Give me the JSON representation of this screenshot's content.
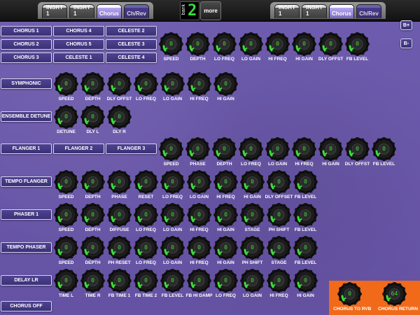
{
  "topbar": {
    "left_tabs": [
      {
        "label": "INSRT 1",
        "state": "normal"
      },
      {
        "label": "INSRT 1",
        "state": "normal"
      },
      {
        "label": "Chorus",
        "state": "active"
      },
      {
        "label": "Ch/Rev",
        "state": "dark"
      }
    ],
    "right_tabs": [
      {
        "label": "INSRT 1",
        "state": "normal"
      },
      {
        "label": "INSRT 1",
        "state": "normal"
      },
      {
        "label": "Chorus",
        "state": "active"
      },
      {
        "label": "Ch/Rev",
        "state": "dark"
      }
    ],
    "bank_label": "bank",
    "bank_number": "2",
    "more_label": "more"
  },
  "bank_buttons": {
    "plus": "B+",
    "minus": "B-"
  },
  "colors": {
    "accent_green": "#3cdc3c",
    "panel_purple": "#6a58a8",
    "return_orange": "#f06a1a"
  },
  "chorus_buttons": [
    "CHORUS 1",
    "CHORUS 4",
    "CELESTE 2",
    "CHORUS 2",
    "CHORUS 5",
    "CELESTE 3",
    "CHORUS 3",
    "CELESTE 1",
    "CELESTE 4"
  ],
  "sections": [
    {
      "id": "chorus",
      "knobs": [
        {
          "label": "SPEED",
          "value": "0"
        },
        {
          "label": "DEPTH",
          "value": "0"
        },
        {
          "label": "LO FREQ",
          "value": "0"
        },
        {
          "label": "LO GAIN",
          "value": "0"
        },
        {
          "label": "HI FREQ",
          "value": "0"
        },
        {
          "label": "HI GAIN",
          "value": "0"
        },
        {
          "label": "DLY OFFST",
          "value": "0"
        },
        {
          "label": "FB LEVEL",
          "value": "0"
        }
      ]
    },
    {
      "id": "symphonic",
      "button": "SYMPHONIC",
      "knobs": [
        {
          "label": "SPEED",
          "value": "0"
        },
        {
          "label": "DEPTH",
          "value": "0"
        },
        {
          "label": "DLY OFFST",
          "value": "0"
        },
        {
          "label": "LO FREQ",
          "value": "0"
        },
        {
          "label": "LO GAIN",
          "value": "0"
        },
        {
          "label": "HI FREQ",
          "value": "0"
        },
        {
          "label": "HI GAIN",
          "value": "0"
        }
      ]
    },
    {
      "id": "ensemble",
      "button": "ENSEMBLE DETUNE",
      "knobs": [
        {
          "label": "DETUNE",
          "value": "0"
        },
        {
          "label": "DLY L",
          "value": "0"
        },
        {
          "label": "DLY R",
          "value": "0"
        }
      ]
    },
    {
      "id": "flanger",
      "buttons": [
        "FLANGER 1",
        "FLANGER 2",
        "FLANGER 3"
      ],
      "knobs": [
        {
          "label": "SPEED",
          "value": "0"
        },
        {
          "label": "PHASE",
          "value": "0"
        },
        {
          "label": "DEPTH",
          "value": "0"
        },
        {
          "label": "LO FREQ",
          "value": "0"
        },
        {
          "label": "LO GAIN",
          "value": "0"
        },
        {
          "label": "HI FREQ",
          "value": "0"
        },
        {
          "label": "HI GAIN",
          "value": "0"
        },
        {
          "label": "DLY OFFST",
          "value": "0"
        },
        {
          "label": "FB LEVEL",
          "value": "0"
        }
      ]
    },
    {
      "id": "tempo_flanger",
      "button": "TEMPO FLANGER",
      "knobs": [
        {
          "label": "SPEED",
          "value": "0"
        },
        {
          "label": "DEPTH",
          "value": "0"
        },
        {
          "label": "PHASE",
          "value": "0"
        },
        {
          "label": "RESET",
          "value": "0"
        },
        {
          "label": "LO FREQ",
          "value": "0"
        },
        {
          "label": "LO GAIN",
          "value": "0"
        },
        {
          "label": "HI FREQ",
          "value": "0"
        },
        {
          "label": "HI GAIN",
          "value": "0"
        },
        {
          "label": "DLY OFFSET",
          "value": "0"
        },
        {
          "label": "FB LEVEL",
          "value": "0"
        }
      ]
    },
    {
      "id": "phaser",
      "button": "PHASER 1",
      "knobs": [
        {
          "label": "SPEED",
          "value": "0"
        },
        {
          "label": "DEPTH",
          "value": "0"
        },
        {
          "label": "DIFFUSE",
          "value": "0"
        },
        {
          "label": "LO FREQ",
          "value": "0"
        },
        {
          "label": "LO GAIN",
          "value": "0"
        },
        {
          "label": "HI FREQ",
          "value": "0"
        },
        {
          "label": "HI GAIN",
          "value": "0"
        },
        {
          "label": "STAGE",
          "value": "0"
        },
        {
          "label": "PH SHIFT",
          "value": "0"
        },
        {
          "label": "FB LEVEL",
          "value": "0"
        }
      ]
    },
    {
      "id": "tempo_phaser",
      "button": "TEMPO PHASER",
      "knobs": [
        {
          "label": "SPEED",
          "value": "0"
        },
        {
          "label": "DEPTH",
          "value": "0"
        },
        {
          "label": "PH RESET",
          "value": "0"
        },
        {
          "label": "LO FREQ",
          "value": "0"
        },
        {
          "label": "LO GAIN",
          "value": "0"
        },
        {
          "label": "HI FREQ",
          "value": "0"
        },
        {
          "label": "HI GAIN",
          "value": "0"
        },
        {
          "label": "PH SHIFT",
          "value": "0"
        },
        {
          "label": "STAGE",
          "value": "0"
        },
        {
          "label": "FB LEVEL",
          "value": "0"
        }
      ]
    },
    {
      "id": "delay_lr",
      "button": "DELAY LR",
      "knobs": [
        {
          "label": "TIME L",
          "value": "0"
        },
        {
          "label": "TIME R",
          "value": "0"
        },
        {
          "label": "FB TIME 1",
          "value": "0"
        },
        {
          "label": "FB TIME 2",
          "value": "0"
        },
        {
          "label": "FB LEVEL",
          "value": "0"
        },
        {
          "label": "FB HI DAMP",
          "value": "0"
        },
        {
          "label": "LO FREQ",
          "value": "0"
        },
        {
          "label": "LO GAIN",
          "value": "0"
        },
        {
          "label": "HI FREQ",
          "value": "0"
        },
        {
          "label": "HI GAIN",
          "value": "0"
        }
      ]
    }
  ],
  "chorus_off": "CHORUS OFF",
  "returns": [
    {
      "label": "CHORUS TO RVB",
      "value": "0"
    },
    {
      "label": "CHORUS RETURN",
      "value": "64"
    }
  ]
}
